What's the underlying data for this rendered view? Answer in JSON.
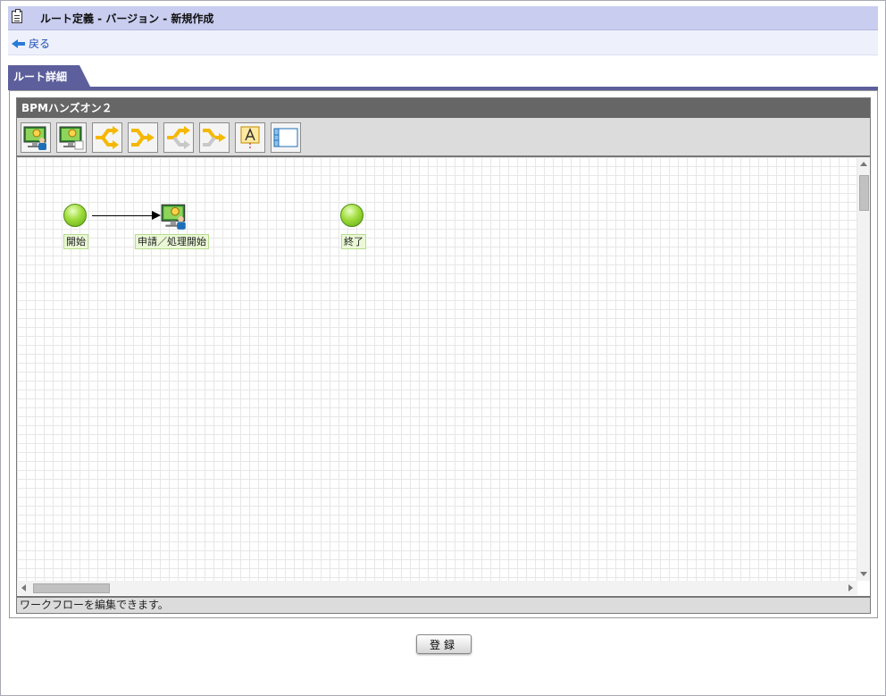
{
  "header": {
    "title": "ルート定義 - バージョン - 新規作成",
    "icon": "document-icon"
  },
  "nav": {
    "back_label": "戻る",
    "back_icon": "back-arrow-icon"
  },
  "tabs": [
    {
      "label": "ルート詳細",
      "active": true
    }
  ],
  "flow": {
    "name": "BPMハンズオン２",
    "toolbar": [
      {
        "name": "user-task-icon"
      },
      {
        "name": "system-task-icon"
      },
      {
        "name": "split-icon"
      },
      {
        "name": "merge-icon"
      },
      {
        "name": "split-disabled-icon"
      },
      {
        "name": "merge-disabled-icon"
      },
      {
        "name": "text-annotation-icon"
      },
      {
        "name": "swimlane-icon"
      }
    ],
    "nodes": {
      "start": "開始",
      "task": "申請／処理開始",
      "end": "終了"
    },
    "status": "ワークフローを編集できます。"
  },
  "actions": {
    "register_label": "登録"
  },
  "colors": {
    "accent": "#5c5f9c",
    "title_bg": "#c9cdef",
    "node_green": "#8fd42e",
    "arrow_orange": "#f5b800"
  }
}
